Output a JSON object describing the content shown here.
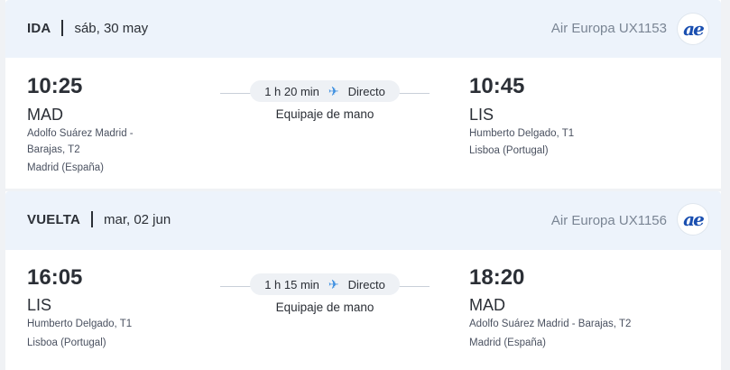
{
  "legs": [
    {
      "direction": "IDA",
      "date": "sáb, 30 may",
      "airline": "Air Europa UX1153",
      "airline_logo_text": "ae",
      "departure": {
        "time": "10:25",
        "code": "MAD",
        "airport_line1": "Adolfo Suárez Madrid -",
        "airport_line2": "Barajas, T2",
        "city": "Madrid (España)"
      },
      "duration": "1 h 20 min",
      "stops": "Directo",
      "baggage": "Equipaje de mano",
      "arrival": {
        "time": "10:45",
        "code": "LIS",
        "airport_line1": "Humberto Delgado, T1",
        "city": "Lisboa (Portugal)"
      }
    },
    {
      "direction": "VUELTA",
      "date": "mar, 02 jun",
      "airline": "Air Europa UX1156",
      "airline_logo_text": "ae",
      "departure": {
        "time": "16:05",
        "code": "LIS",
        "airport_line1": "Humberto Delgado, T1",
        "city": "Lisboa (Portugal)"
      },
      "duration": "1 h 15 min",
      "stops": "Directo",
      "baggage": "Equipaje de mano",
      "arrival": {
        "time": "18:20",
        "code": "MAD",
        "airport_line1": "Adolfo Suárez Madrid - Barajas, T2",
        "city": "Madrid (España)"
      }
    }
  ],
  "icons": {
    "plane": "airplane-icon",
    "logo": "air-europa-logo"
  },
  "colors": {
    "header_bg": "#edf3fb",
    "plane": "#3d8fe0",
    "logo": "#1a4fb0",
    "airline_text": "#7a8594"
  }
}
